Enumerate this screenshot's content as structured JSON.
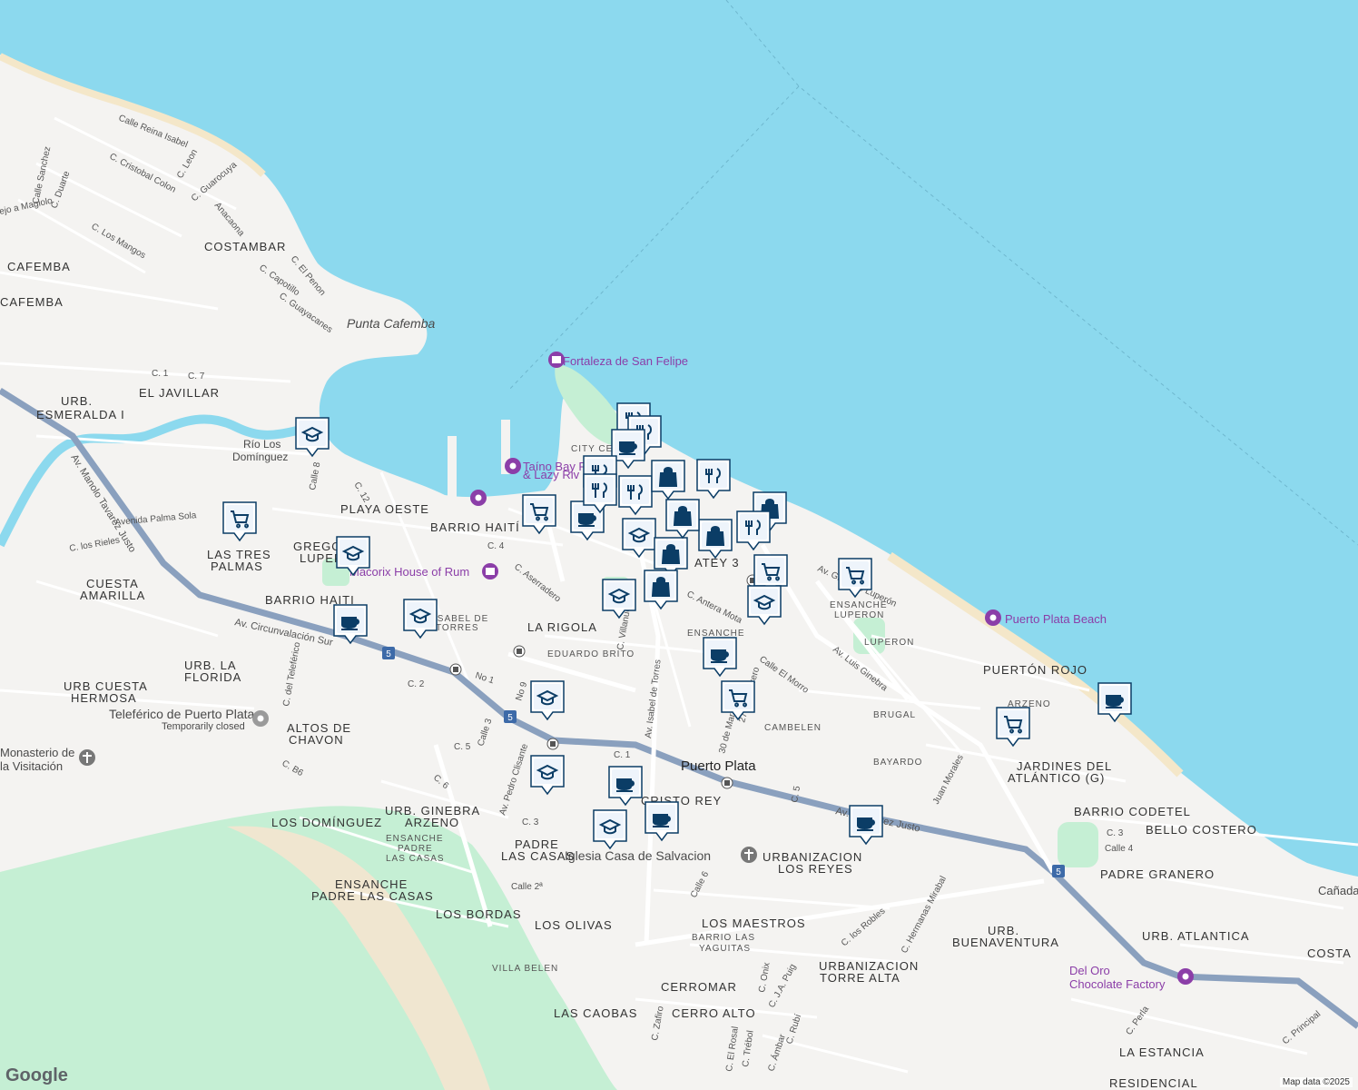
{
  "map": {
    "attribution": "Map data ©2025",
    "logo": "Google",
    "city_label": "Puerto Plata",
    "colors": {
      "water": "#8cd9ee",
      "land": "#f4f3f1",
      "park": "#c5efd4",
      "sand": "#f4e7c9",
      "highway": "#8aa0be",
      "marker": "#0b3d66",
      "poi": "#8b3ea8"
    },
    "pois": [
      {
        "name": "Fortaleza de San Felipe",
        "icon": "museum-icon"
      },
      {
        "name": "Taíno Bay Port & Lazy River",
        "icon": "camera-icon"
      },
      {
        "name": "Macorix House of Rum",
        "icon": "museum-icon"
      },
      {
        "name": "Puerto Plata Beach",
        "icon": "camera-icon"
      },
      {
        "name": "Teleférico de Puerto Plata",
        "note": "Temporarily closed",
        "icon": "camera-icon"
      },
      {
        "name": "Monasterio de la Visitación",
        "icon": "church-icon"
      },
      {
        "name": "Iglesia Casa de Salvacion",
        "icon": "church-icon"
      },
      {
        "name": "Del Oro Chocolate Factory",
        "icon": "camera-icon"
      },
      {
        "name": "Punta Cafemba",
        "icon": "none"
      },
      {
        "name": "Río Los Domínguez",
        "icon": "none"
      },
      {
        "name": "Cañada",
        "icon": "none"
      }
    ],
    "neighborhoods": [
      "COSTAMBAR",
      "CAFEMBA",
      "EL JAVILLAR",
      "URB. ESMERALDA I",
      "PLAYA OESTE",
      "BARRIO HAITÍ",
      "LAS TRES PALMAS",
      "CUESTA AMARILLA",
      "BARRIO HAITI",
      "URB. LA FLORIDA",
      "URB CUESTA HERMOSA",
      "ALTOS DE CHAVON",
      "LA RIGOLA",
      "EDUARDO BRITO",
      "URB. GINEBRA ARZENO",
      "LOS DOMÍNGUEZ",
      "PADRE LAS CASAS",
      "ENSANCHE PADRE LAS CASAS",
      "LOS BORDAS",
      "LOS OLIVAS",
      "VILLA BELEN",
      "LAS CAOBAS",
      "CERROMAR",
      "CERRO ALTO",
      "LOS MAESTROS",
      "BARRIO LAS YAGUITAS",
      "URBANIZACION LOS REYES",
      "URBANIZACION TORRE ALTA",
      "URB. BUENAVENTURA",
      "BRUGAL",
      "BAYARDO",
      "CAMBELEN",
      "LUPERON",
      "ENSANCHE LUPERON",
      "PUERTÓN ROJO",
      "ARZENO",
      "JARDINES DEL ATLÁNTICO (G)",
      "BARRIO CODETEL",
      "BELLO COSTERO",
      "PADRE GRANERO",
      "URB. ATLANTICA",
      "COSTA",
      "LA ESTANCIA",
      "RESIDENCIAL",
      "CRISTO REY",
      "CITY CENTER",
      "BATEY 3",
      "GREGORIO LUPERÓN"
    ],
    "streets": [
      "Calle Reina Isabel",
      "C. Cristobal Colon",
      "C. Leon",
      "C. Guarocuya",
      "Calle Sanchez",
      "C. Duarte",
      "Anacaona",
      "C. Los Mangos",
      "ejo a Magiolo",
      "C. El Penon",
      "C. Capotillo",
      "C. Guayacanes",
      "Av. Manolo Tavarez Justo",
      "Avenida Palma Sola",
      "C. los Rieles",
      "Av. Circunvalación Sur",
      "C. del Teleférico",
      "C. Aserradero",
      "C. Villanueva",
      "Av. Isabel de Torres",
      "C. Antera Mota",
      "Calle El Morro",
      "30 de Marzo",
      "27 de Febrero",
      "Av. Gregorio Luperón",
      "Av. Luis Ginebra",
      "Juan Morales",
      "C. J.A. Puig",
      "C. Hermanas Mirabal",
      "C. los Robles",
      "Calle 4",
      "Calle 2ª",
      "Calle 6",
      "C. Zafiro",
      "C. Onix",
      "C. El Rosal",
      "C. Trébol",
      "C. Rubí",
      "C. Ámbar",
      "C. Perla",
      "C. Principal",
      "Av. Pedro Clisante",
      "No 1",
      "No 9",
      "C. 1",
      "C. 2",
      "C. 3",
      "C. 4",
      "C. 5",
      "C. 6",
      "C. 7",
      "C. 8",
      "C. 12",
      "C. B6",
      "Calle 3",
      "Calle 8"
    ],
    "highway_shields": [
      "5",
      "5",
      "5"
    ],
    "markers": [
      {
        "type": "school-icon"
      },
      {
        "type": "cart-icon"
      },
      {
        "type": "school-icon"
      },
      {
        "type": "coffee-icon"
      },
      {
        "type": "school-icon"
      },
      {
        "type": "cart-icon"
      },
      {
        "type": "coffee-icon"
      },
      {
        "type": "restaurant-icon"
      },
      {
        "type": "restaurant-icon"
      },
      {
        "type": "coffee-icon"
      },
      {
        "type": "restaurant-icon"
      },
      {
        "type": "restaurant-icon"
      },
      {
        "type": "shopping-bag-icon"
      },
      {
        "type": "restaurant-icon"
      },
      {
        "type": "shopping-bag-icon"
      },
      {
        "type": "school-icon"
      },
      {
        "type": "shopping-bag-icon"
      },
      {
        "type": "shopping-bag-icon"
      },
      {
        "type": "shopping-bag-icon"
      },
      {
        "type": "restaurant-icon"
      },
      {
        "type": "shopping-bag-icon"
      },
      {
        "type": "cart-icon"
      },
      {
        "type": "school-icon"
      },
      {
        "type": "school-icon"
      },
      {
        "type": "coffee-icon"
      },
      {
        "type": "cart-icon"
      },
      {
        "type": "school-icon"
      },
      {
        "type": "cart-icon"
      },
      {
        "type": "school-icon"
      },
      {
        "type": "coffee-icon"
      },
      {
        "type": "school-icon"
      },
      {
        "type": "coffee-icon"
      },
      {
        "type": "coffee-icon"
      },
      {
        "type": "cart-icon"
      },
      {
        "type": "coffee-icon"
      },
      {
        "type": "restaurant-icon"
      }
    ]
  }
}
